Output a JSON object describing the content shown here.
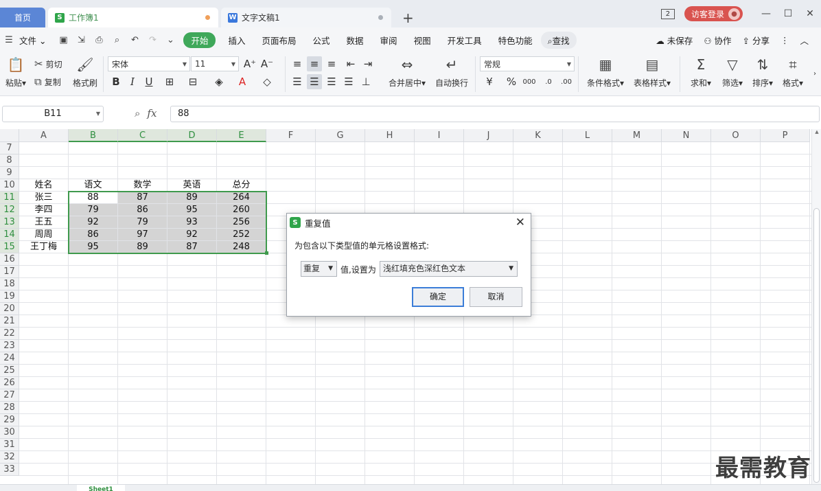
{
  "tabs": {
    "home": "首页",
    "workbook": "工作簿1",
    "document": "文字文稿1",
    "new_tab": "+"
  },
  "titlebar": {
    "window_count": "2",
    "login": "访客登录",
    "minimize": "—",
    "maximize": "☐",
    "close": "✕"
  },
  "menu": {
    "file": "文件",
    "items": [
      "开始",
      "插入",
      "页面布局",
      "公式",
      "数据",
      "审阅",
      "视图",
      "开发工具",
      "特色功能"
    ],
    "active": "开始",
    "search": "查找",
    "unsaved": "未保存",
    "collab": "协作",
    "share": "分享"
  },
  "ribbon": {
    "paste": "粘贴",
    "cut": "剪切",
    "copy": "复制",
    "format_painter": "格式刷",
    "font_name": "宋体",
    "font_size": "11",
    "number_format": "常规",
    "merge_center": "合并居中",
    "wrap_text": "自动换行",
    "conditional_format": "条件格式",
    "table_style": "表格样式",
    "sum": "求和",
    "filter": "筛选",
    "sort": "排序",
    "format": "格式"
  },
  "formula_bar": {
    "cell_ref": "B11",
    "value": "88"
  },
  "sheet": {
    "columns": [
      "A",
      "B",
      "C",
      "D",
      "E",
      "F",
      "G",
      "H",
      "I",
      "J",
      "K",
      "L",
      "M",
      "N",
      "O",
      "P"
    ],
    "rows": [
      "7",
      "8",
      "9",
      "10",
      "11",
      "12",
      "13",
      "14",
      "15",
      "16",
      "17",
      "18",
      "19",
      "20",
      "21",
      "22",
      "23",
      "24",
      "25",
      "26",
      "27",
      "28",
      "29",
      "30",
      "31",
      "32",
      "33"
    ],
    "header_row": [
      "姓名",
      "语文",
      "数学",
      "英语",
      "总分"
    ],
    "data": [
      [
        "张三",
        "88",
        "87",
        "89",
        "264"
      ],
      [
        "李四",
        "79",
        "86",
        "95",
        "260"
      ],
      [
        "王五",
        "92",
        "79",
        "93",
        "256"
      ],
      [
        "周周",
        "86",
        "97",
        "92",
        "252"
      ],
      [
        "王丁梅",
        "95",
        "89",
        "87",
        "248"
      ]
    ],
    "sheet_tab": "Sheet1"
  },
  "dialog": {
    "title": "重复值",
    "message": "为包含以下类型值的单元格设置格式:",
    "type_value": "重复",
    "set_label": "值,设置为",
    "format_value": "浅红填充色深红色文本",
    "ok": "确定",
    "cancel": "取消"
  },
  "watermark": "最需教育"
}
